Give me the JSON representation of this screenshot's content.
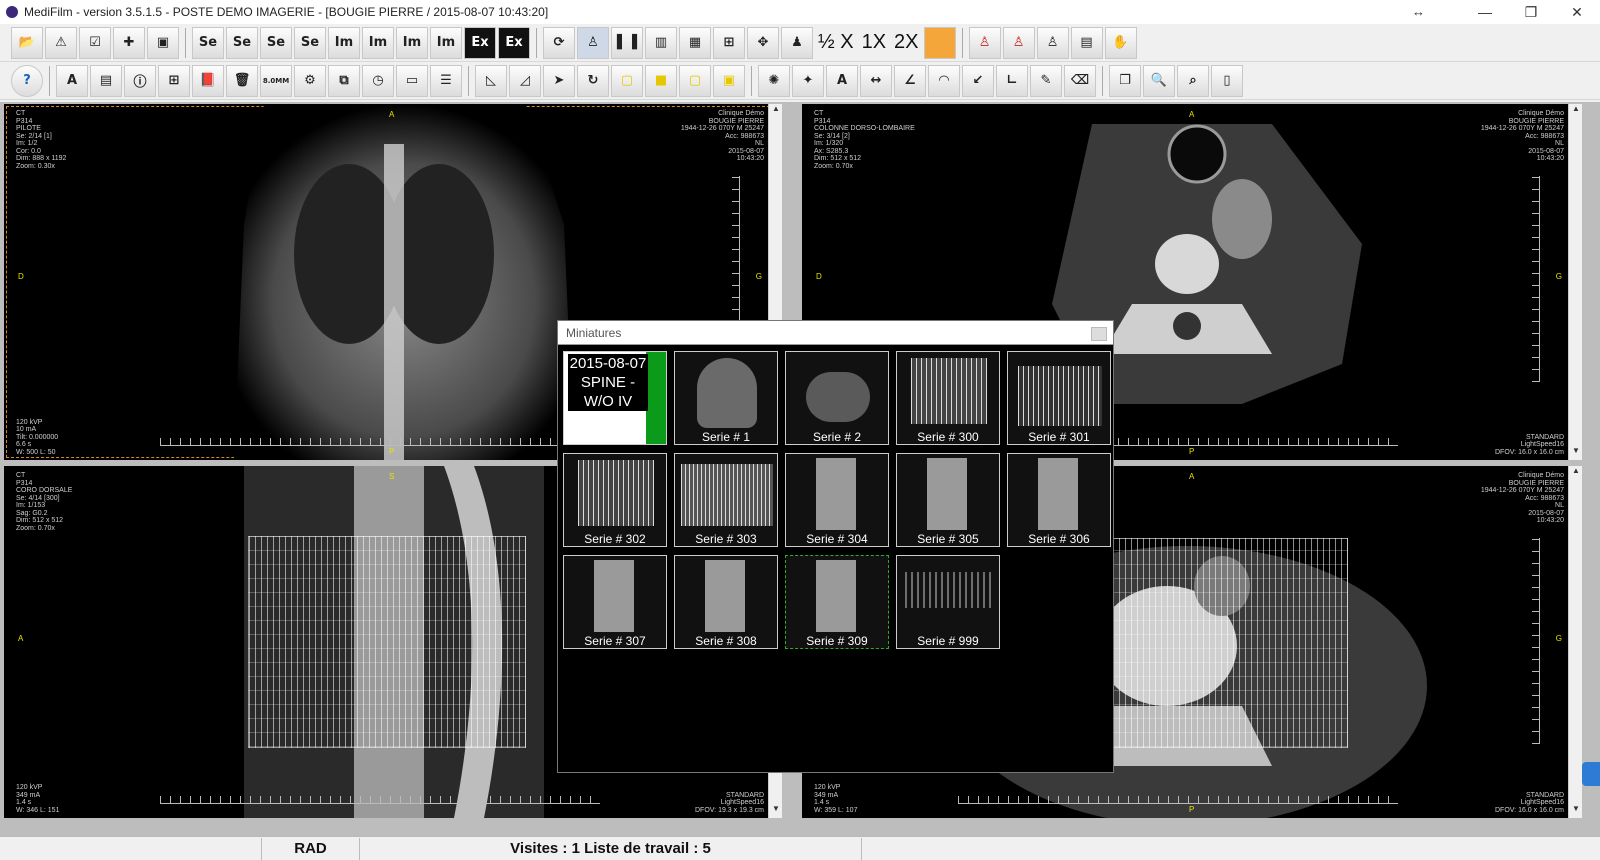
{
  "window": {
    "title": "MediFilm - version 3.5.1.5 - POSTE DEMO IMAGERIE - [BOUGIE PIERRE / 2015-08-07 10:43:20]",
    "minimize": "—",
    "maximize": "❐",
    "close": "✕",
    "resize_glyph": "↔"
  },
  "toolbar1": {
    "buttons": [
      "Se",
      "Se",
      "Se",
      "Se",
      "Im",
      "Im",
      "Im",
      "Im",
      "Ex",
      "Ex"
    ],
    "zoom_half": "½ X",
    "zoom_1x": "1X",
    "zoom_2x": "2X"
  },
  "toolbar2": {
    "scale_label": "8.0MM"
  },
  "viewports": [
    {
      "left_info": "CT\nP314\nPILOTE\nSe: 2/14 [1]\nIm: 1/2\nCor: 0.0\nDim: 888 x 1192\nZoom: 0.30x",
      "right_info": "Clinique Démo\nBOUGIE PIERRE\n1944-12-26 070Y M 25247\nAcc: 988673\nNL\n2015-08-07\n10:43:20",
      "bottom_left": "120 kVP\n10 mA\nTilt: 0.000000\n6.6 s\nW: 500 L: 50",
      "bottom_right": "",
      "orient_top": "A",
      "orient_left": "D",
      "orient_right": "G",
      "orient_bottom": "P"
    },
    {
      "left_info": "CT\nP314\nCOLONNE DORSO-LOMBAIRE\nSe: 3/14 [2]\nIm: 1/320\nAx: S285.3\nDim: 512 x 512\nZoom: 0.70x",
      "right_info": "Clinique Démo\nBOUGIE PIERRE\n1944-12-26 070Y M 25247\nAcc: 988673\nNL\n2015-08-07\n10:43:20",
      "bottom_left": "",
      "bottom_right": "STANDARD\nLightSpeed16\nDFOV: 16.0 x 16.0 cm",
      "orient_top": "A",
      "orient_left": "D",
      "orient_right": "G",
      "orient_bottom": "P"
    },
    {
      "left_info": "CT\nP314\nCORO DORSALE\nSe: 4/14 [300]\nIm: 1/153\nSag: G0.2\nDim: 512 x 512\nZoom: 0.70x",
      "right_info": "",
      "bottom_left": "120 kVP\n349 mA\n1.4 s\nW: 346 L: 151",
      "bottom_right": "STANDARD\nLightSpeed16\nDFOV: 19.3 x 19.3 cm",
      "orient_top": "S",
      "orient_left": "A",
      "orient_right": "",
      "orient_bottom": ""
    },
    {
      "left_info": "",
      "right_info": "Clinique Démo\nBOUGIE PIERRE\n1944-12-26 070Y M 25247\nAcc: 988673\nNL\n2015-08-07\n10:43:20",
      "bottom_left": "120 kVP\n349 mA\n1.4 s\nW: 359 L: 107",
      "bottom_right": "STANDARD\nLightSpeed16\nDFOV: 16.0 x 16.0 cm",
      "orient_top": "A",
      "orient_left": "",
      "orient_right": "G",
      "orient_bottom": "P"
    }
  ],
  "miniatures": {
    "title": "Miniatures",
    "study_label": "2015-08-07\nSPINE -\nW/O IV",
    "thumbs": [
      "Serie # 1",
      "Serie # 2",
      "Serie # 300",
      "Serie # 301",
      "Serie # 302",
      "Serie # 303",
      "Serie # 304",
      "Serie # 305",
      "Serie # 306",
      "Serie # 307",
      "Serie # 308",
      "Serie # 309",
      "Serie # 999"
    ]
  },
  "statusbar": {
    "user": "RAD",
    "text": "Visites : 1  Liste de travail : 5"
  },
  "colors": {
    "orient": "#e7e400",
    "study_green": "#0c9a1a",
    "selection_orange": "#d98a1a"
  }
}
